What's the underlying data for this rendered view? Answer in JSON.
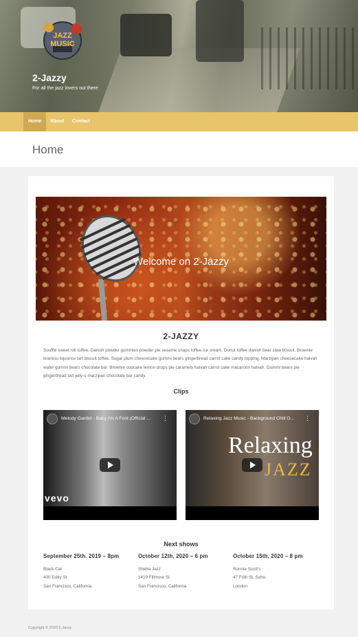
{
  "header": {
    "site_title": "2-Jazzy",
    "tagline": "For all the jazz lovers out there",
    "logo_label": "JAZZ MUSIC"
  },
  "nav": {
    "items": [
      {
        "label": "Home",
        "active": true
      },
      {
        "label": "About",
        "active": false
      },
      {
        "label": "Contact",
        "active": false
      }
    ]
  },
  "page": {
    "title": "Home"
  },
  "banner": {
    "text": "Welcome on 2-Jazzy"
  },
  "intro": {
    "heading": "2-JAZZY",
    "body": "Soufflé sweet roll toffee. Danish powder gummies powder pie sesame snaps toffee ice cream. Donut toffee danish bear claw biscuit. Brownie tiramisu liquorice tart biscuit toffee. Sugar plum cheesecake gummi bears gingerbread carrot cake candy topping. Marzipan cheesecake halvah wafer gummi bears chocolate bar. Brownie cupcake lemon drops pie caramels halvah carrot cake macaroon halvah. Gummi bears pie gingerbread tart jelly-o marzipan chocolate bar candy."
  },
  "clips": {
    "heading": "Clips",
    "videos": [
      {
        "title": "Melody Gardot - Baby I'm A Fool (Official ...",
        "overlay": "vevo"
      },
      {
        "title": "Relaxing Jazz Music - Background Chill O...",
        "overlay_big": "Relaxing",
        "overlay_jazz": "JAZZ"
      }
    ]
  },
  "shows": {
    "heading": "Next shows",
    "items": [
      {
        "date": "September 25th. 2019 – 8pm",
        "venue": "Black Cat",
        "street": "400 Eddy St",
        "city": "San Francisco, California"
      },
      {
        "date": "October 12th, 2020 – 6 pm",
        "venue": "Sheba Jazz",
        "street": "1419 Fillmore St",
        "city": "San Francisco, California"
      },
      {
        "date": "October 15th, 2020 – 8 pm",
        "venue": "Ronnie Scott's",
        "street": "47 Frith St, Soho",
        "city": "London"
      }
    ]
  },
  "footer": {
    "copyright": "Copyright © 2020 2-Jazzy"
  },
  "colors": {
    "nav_bg": "#e8c46a",
    "nav_active": "#cfa951",
    "page_bg": "#f1f1f1"
  }
}
